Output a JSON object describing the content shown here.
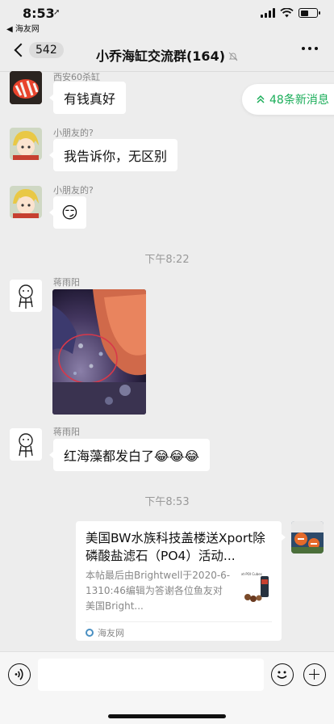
{
  "status_bar": {
    "time": "8:53",
    "back_app": "◀ 海友网"
  },
  "nav": {
    "unread_count": "542",
    "title": "小乔海缸交流群(164)"
  },
  "new_messages_pill": "48条新消息",
  "messages": [
    {
      "sender": "西安60杀缸",
      "text": "有钱真好"
    },
    {
      "sender": "小朋友的?",
      "text": "我告诉你，无区别"
    },
    {
      "sender": "小朋友的?",
      "emoji": "😏"
    },
    {
      "time": "下午8:22"
    },
    {
      "sender": "蒋雨阳",
      "type": "image"
    },
    {
      "sender": "蒋雨阳",
      "text": "红海藻都发白了😂😂😂"
    },
    {
      "time": "下午8:53"
    }
  ],
  "link_card": {
    "title": "美国BW水族科技盖楼送Xport除磷酸盐滤石（PO4）活动...",
    "description": "本帖最后由Brightwell于2020-6-1310:46编辑为答谢各位鱼友对美国Bright...",
    "thumb_text": "xt-POI Cubes",
    "source": "海友网"
  },
  "colors": {
    "background": "#ededed",
    "bubble": "#ffffff",
    "accent_green": "#1aad59",
    "muted_text": "#888888"
  },
  "icons": [
    "back-chevron-icon",
    "mute-bell-icon",
    "more-icon",
    "double-chevron-up-icon",
    "voice-icon",
    "emoji-icon",
    "plus-icon"
  ]
}
